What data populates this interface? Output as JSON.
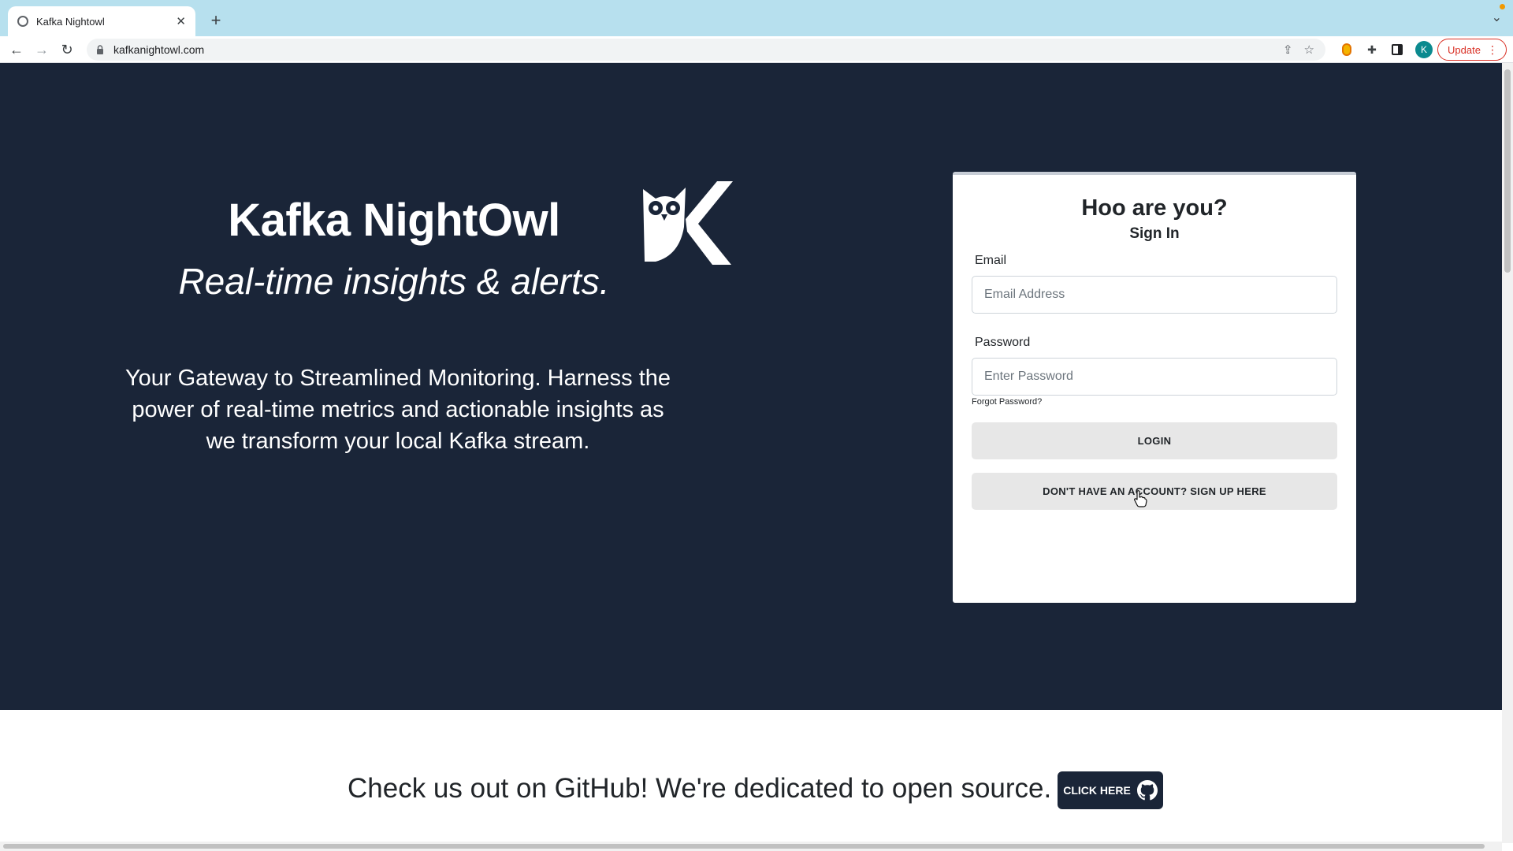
{
  "browser": {
    "tab_title": "Kafka Nightowl",
    "url": "kafkanightowl.com",
    "update_label": "Update",
    "profile_initial": "K"
  },
  "hero": {
    "title": "Kafka NightOwl",
    "tagline": "Real-time insights & alerts.",
    "description": "Your Gateway to Streamlined Monitoring. Harness the power of real-time metrics and actionable insights as we transform your local Kafka stream."
  },
  "login": {
    "heading": "Hoo are you?",
    "subheading": "Sign In",
    "email_label": "Email",
    "email_placeholder": "Email Address",
    "email_value": "",
    "password_label": "Password",
    "password_placeholder": "Enter Password",
    "password_value": "",
    "forgot_label": "Forgot Password?",
    "login_label": "LOGIN",
    "signup_label": "DON'T HAVE AN ACCOUNT? SIGN UP HERE"
  },
  "footer": {
    "text": "Check us out on GitHub! We're dedicated to open source.",
    "button_label": "CLICK HERE"
  },
  "colors": {
    "hero_background": "#1a2538",
    "card_background": "#ffffff",
    "button_background": "#e7e7e7",
    "update_accent": "#d93025"
  }
}
